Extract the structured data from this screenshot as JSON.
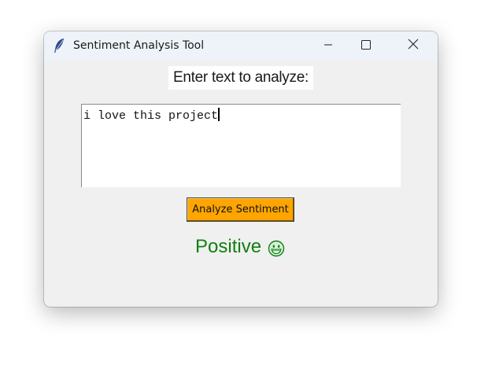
{
  "window": {
    "title": "Sentiment Analysis Tool",
    "icon": "feather-icon",
    "controls": [
      "minimize-icon",
      "maximize-icon",
      "close-icon"
    ]
  },
  "main": {
    "prompt_label": "Enter text to analyze:",
    "input_value": "i love this project",
    "button_label": "Analyze Sentiment",
    "result_label": "Positive",
    "result_icon": "grinning-face-icon"
  },
  "colors": {
    "button_bg": "#ffa500",
    "result_text": "#118011",
    "titlebar_bg": "#eef3f9",
    "window_bg": "#f0f0f0"
  }
}
